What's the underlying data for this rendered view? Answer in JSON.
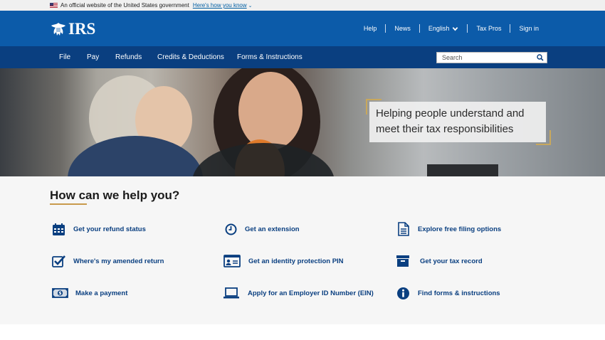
{
  "gov_banner": {
    "text": "An official website of the United States government",
    "link": "Here's how you know"
  },
  "header": {
    "logo_text": "IRS",
    "util_nav": [
      "Help",
      "News",
      "English",
      "Tax Pros",
      "Sign in"
    ]
  },
  "main_nav": {
    "items": [
      "File",
      "Pay",
      "Refunds",
      "Credits & Deductions",
      "Forms & Instructions"
    ],
    "search_placeholder": "Search"
  },
  "hero": {
    "caption_line1": "Helping people understand and",
    "caption_line2": "meet their tax responsibilities"
  },
  "help": {
    "title": "How can we help you?",
    "links": [
      {
        "label": "Get your refund status",
        "icon": "calendar-icon"
      },
      {
        "label": "Get an extension",
        "icon": "clock-icon"
      },
      {
        "label": "Explore free filing options",
        "icon": "document-icon"
      },
      {
        "label": "Where's my amended return",
        "icon": "checkbox-icon"
      },
      {
        "label": "Get an identity protection PIN",
        "icon": "id-card-icon"
      },
      {
        "label": "Get your tax record",
        "icon": "archive-icon"
      },
      {
        "label": "Make a payment",
        "icon": "money-icon"
      },
      {
        "label": "Apply for an Employer ID Number (EIN)",
        "icon": "laptop-icon"
      },
      {
        "label": "Find forms & instructions",
        "icon": "info-icon"
      }
    ]
  },
  "colors": {
    "header_blue": "#0c5ba9",
    "nav_navy": "#0a3f80",
    "link_navy": "#0a3f80",
    "accent_gold": "#c99a4c"
  }
}
